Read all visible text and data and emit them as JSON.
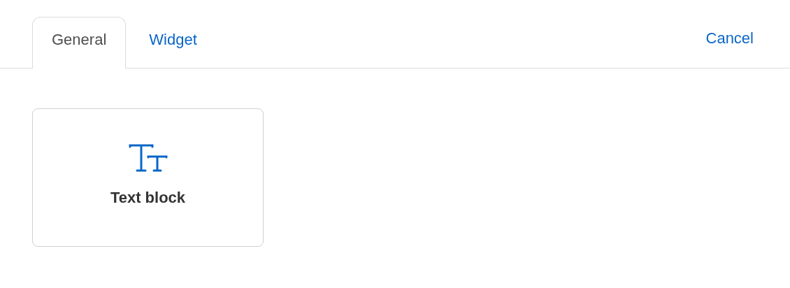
{
  "tabs": [
    {
      "label": "General",
      "selected": true
    },
    {
      "label": "Widget",
      "selected": false
    }
  ],
  "cancel": {
    "label": "Cancel"
  },
  "items": [
    {
      "label": "Text block",
      "kind": "text"
    }
  ]
}
